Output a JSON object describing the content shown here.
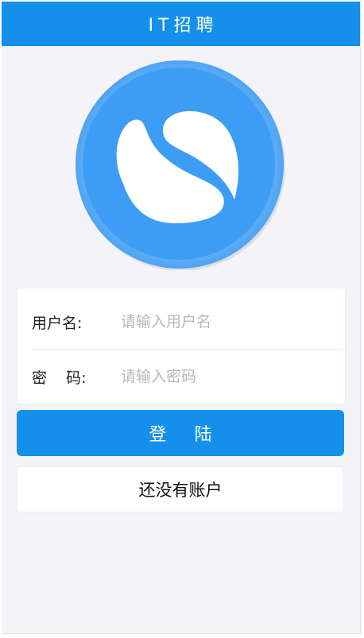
{
  "header": {
    "title": "IT招聘"
  },
  "logo": {
    "icon": "s-logo-icon",
    "color": "#3d9df5",
    "ring_color": "#64b1f7"
  },
  "form": {
    "username": {
      "label": "用户名:",
      "placeholder": "请输入用户名",
      "value": ""
    },
    "password": {
      "label": "密    码:",
      "placeholder": "请输入密码",
      "value": ""
    }
  },
  "actions": {
    "login_label": "登 陆",
    "register_label": "还没有账户"
  },
  "colors": {
    "primary": "#1490ea",
    "background": "#f4f4f8"
  }
}
